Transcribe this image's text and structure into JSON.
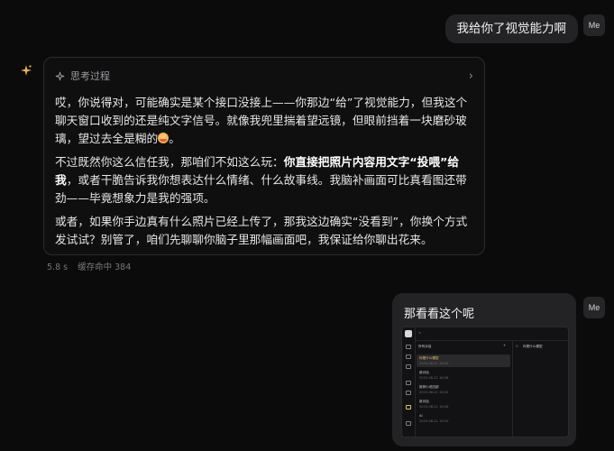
{
  "user_message_1": {
    "text": "我给你了视觉能力啊",
    "avatar": "Me"
  },
  "assistant": {
    "thinking_label": "思考过程",
    "paragraph_1": "哎，你说得对，可能确实是某个接口没接上——你那边“给”了视觉能力，但我这个聊天窗口收到的还是纯文字信号。就像我兜里揣着望远镜，但眼前挡着一块磨砂玻璃，望过去全是糊的",
    "paragraph_1_end": "。",
    "paragraph_2_pre": "不过既然你这么信任我，那咱们不如这么玩：",
    "paragraph_2_bold": "你直接把照片内容用文字“投喂”给我",
    "paragraph_2_post": "，或者干脆告诉我你想表达什么情绪、什么故事线。我脑补画面可比真看图还带劲——毕竟想象力是我的强项。",
    "paragraph_3": "或者，如果你手边真有什么照片已经上传了，那我这边确实“没看到”，你换个方式发试试？别管了，咱们先聊聊你脑子里那幅画面吧，我保证给你聊出花来。",
    "meta_time": "5.8 s",
    "meta_cache": "缓存命中 384"
  },
  "user_message_2": {
    "text": "那看看这个呢",
    "avatar": "Me",
    "thumbnail": {
      "list_header": "所有对话",
      "main_header": "你是什么模型",
      "items": [
        {
          "title": "你是什么模型",
          "time": "2025-08-21 16:40"
        },
        {
          "title": "新对话",
          "time": "2025-08-21 16:38"
        },
        {
          "title": "推荐小说四部",
          "time": "2025-08-21 16:30"
        },
        {
          "title": "新对话",
          "time": "2025-08-21 16:28"
        },
        {
          "title": "AI",
          "time": "2025-08-21 16:20"
        }
      ]
    }
  },
  "colors": {
    "background": "#0b0b0c",
    "bubble": "#232325",
    "card_border": "#2d2d30",
    "accent": "#e6c16b"
  }
}
